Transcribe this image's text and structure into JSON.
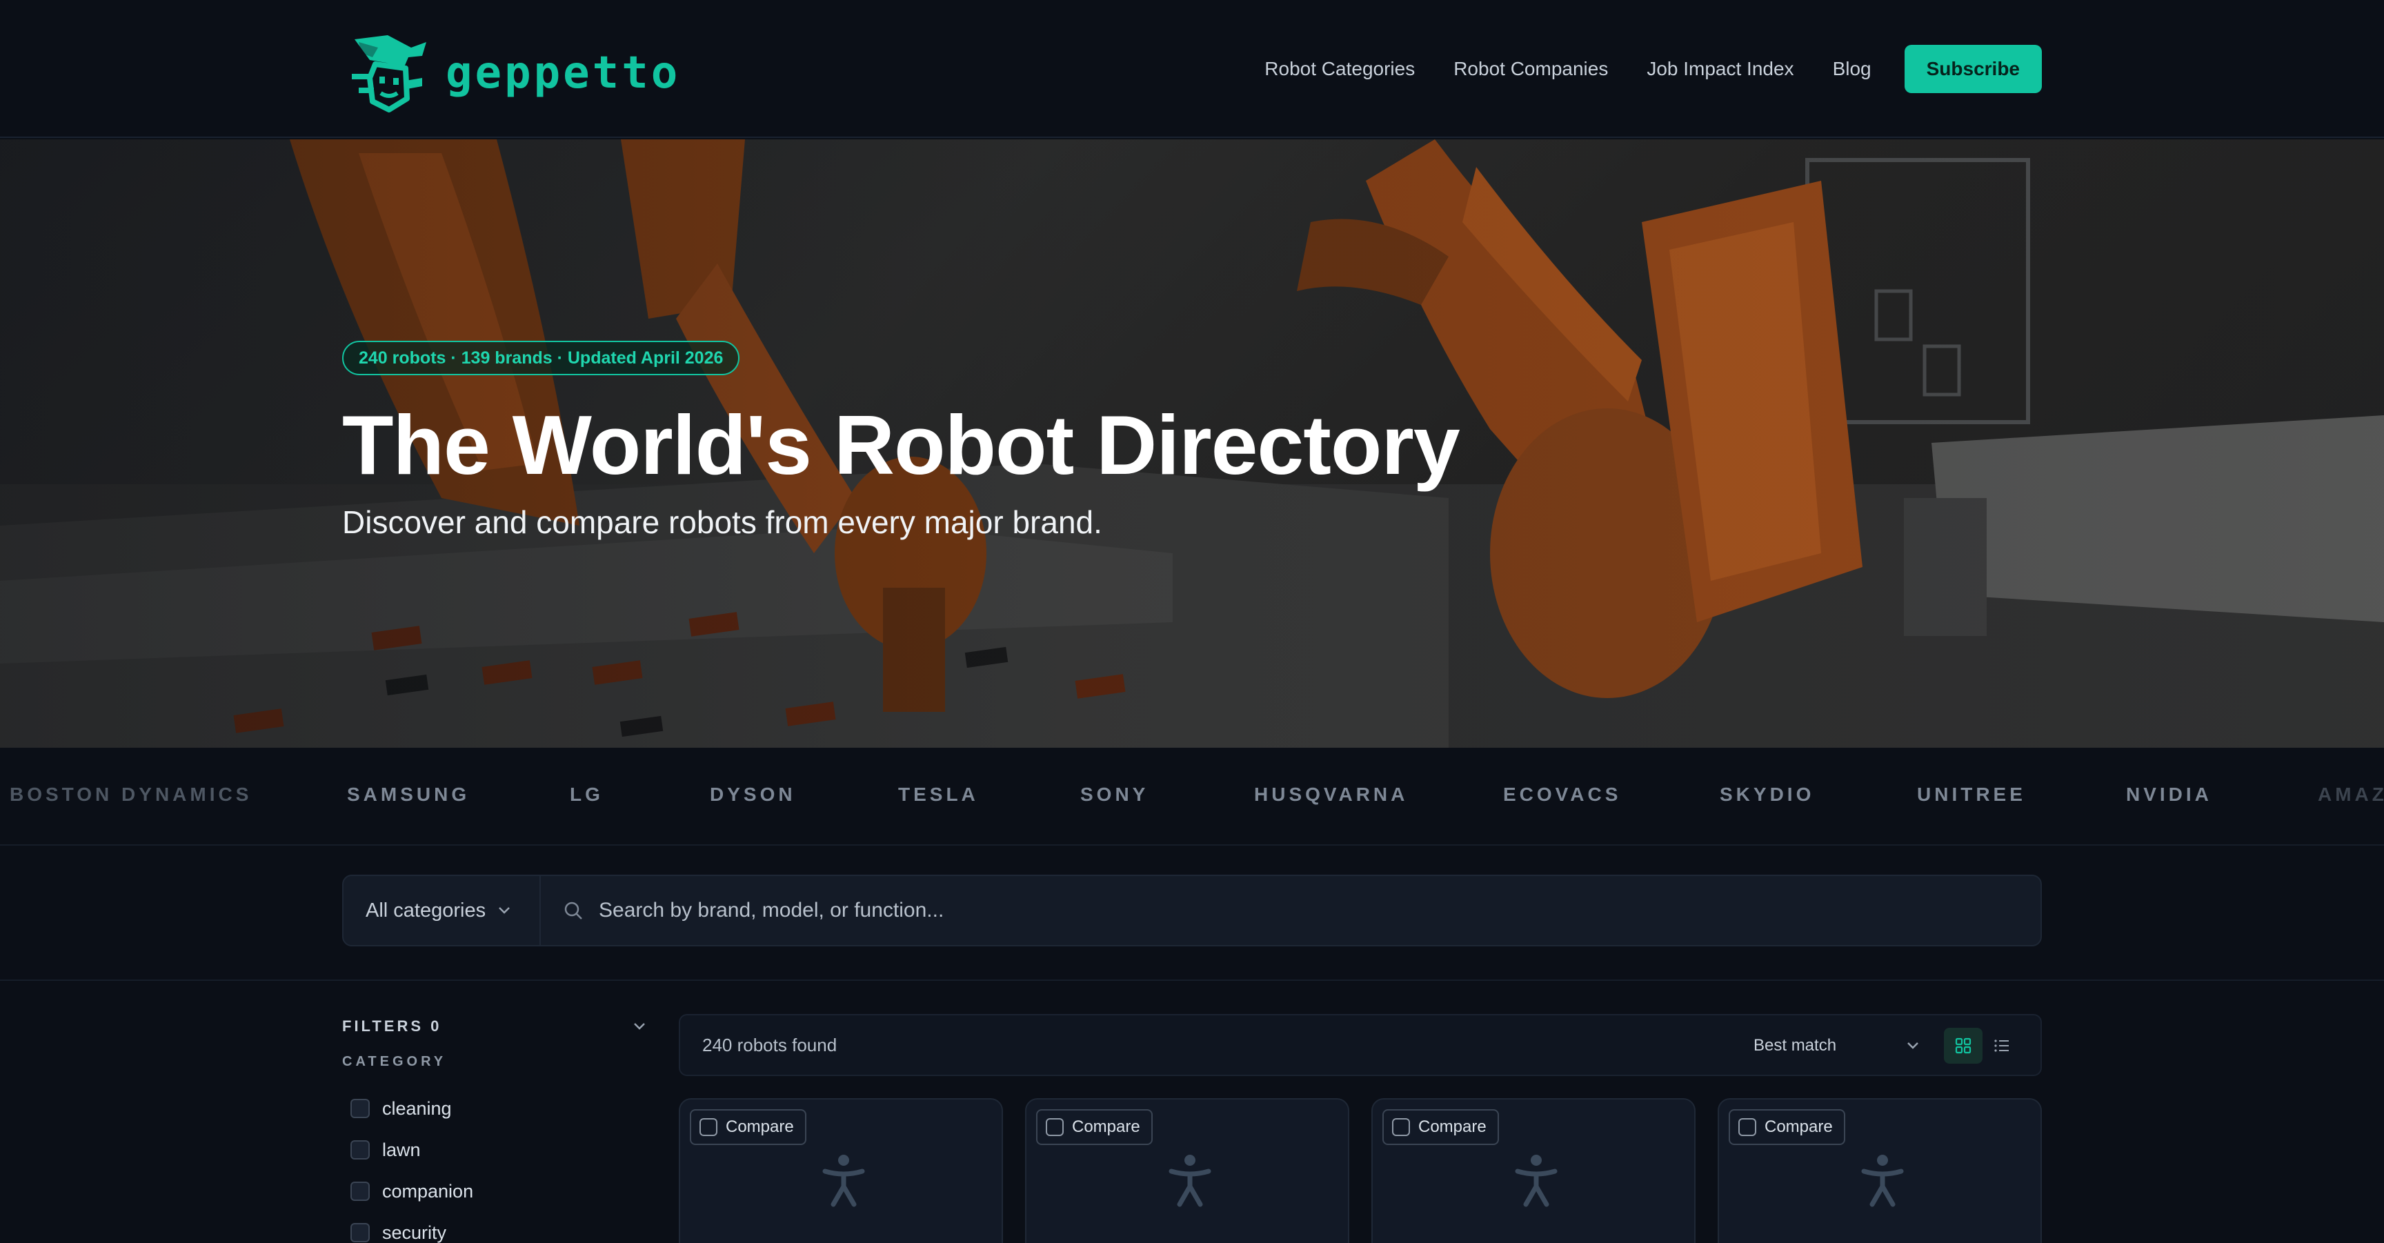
{
  "brand": {
    "name": "geppetto",
    "accent": "#11c4a0"
  },
  "nav": {
    "links": [
      "Robot Categories",
      "Robot Companies",
      "Job Impact Index",
      "Blog"
    ],
    "subscribe_label": "Subscribe"
  },
  "hero": {
    "badge": "240 robots · 139 brands · Updated April 2026",
    "title": "The World's Robot Directory",
    "subtitle": "Discover and compare robots from every major brand."
  },
  "brands_strip": [
    "BOSTON DYNAMICS",
    "SAMSUNG",
    "LG",
    "DYSON",
    "TESLA",
    "SONY",
    "HUSQVARNA",
    "ECOVACS",
    "SKYDIO",
    "UNITREE",
    "NVIDIA",
    "AMAZON"
  ],
  "search": {
    "category_label": "All categories",
    "placeholder": "Search by brand, model, or function..."
  },
  "filters": {
    "title": "FILTERS 0",
    "section_label": "CATEGORY",
    "categories": [
      "cleaning",
      "lawn",
      "companion",
      "security"
    ]
  },
  "results": {
    "count_label": "240 robots found",
    "sort_label": "Best match",
    "view_mode": "grid",
    "cards": [
      {
        "compare_label": "Compare",
        "icon": "robot-figure-icon"
      },
      {
        "compare_label": "Compare",
        "icon": "robot-figure-icon"
      },
      {
        "compare_label": "Compare",
        "icon": "robot-figure-icon"
      },
      {
        "compare_label": "Compare",
        "icon": "robot-figure-icon"
      }
    ]
  }
}
